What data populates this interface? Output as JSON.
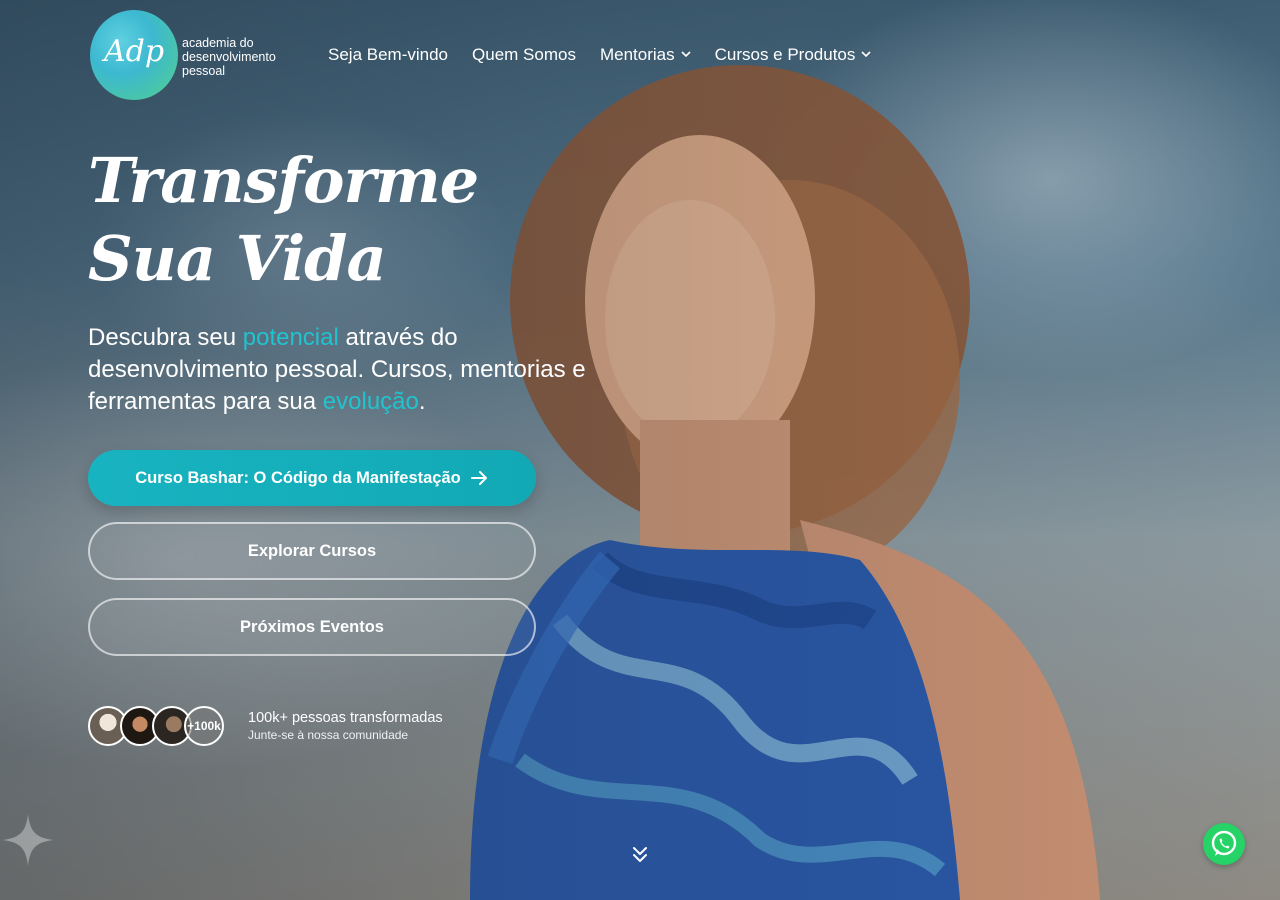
{
  "brand": {
    "logo_mark": "Adp",
    "logo_lines": [
      "academia do",
      "desenvolvimento",
      "pessoal"
    ]
  },
  "nav": {
    "items": [
      {
        "label": "Seja Bem-vindo",
        "has_dropdown": false
      },
      {
        "label": "Quem Somos",
        "has_dropdown": false
      },
      {
        "label": "Mentorias",
        "has_dropdown": true
      },
      {
        "label": "Cursos e Produtos",
        "has_dropdown": true
      }
    ]
  },
  "hero": {
    "headline_line1": "Transforme",
    "headline_line2": "Sua Vida",
    "sub": {
      "p1": "Descubra seu ",
      "accent1": "potencial",
      "p2": " através do desenvolvimento pessoal. Cursos, mentorias e ferramentas para sua ",
      "accent2": "evolução",
      "p3": "."
    },
    "primary_button": "Curso Bashar: O Código da Manifestação",
    "secondary_button_1": "Explorar Cursos",
    "secondary_button_2": "Próximos Eventos"
  },
  "community": {
    "count_badge": "+100k",
    "title": "100k+ pessoas transformadas",
    "subtitle": "Junte-se à nossa comunidade"
  },
  "colors": {
    "accent": "#21c3cf",
    "primary_button": "#14aebb",
    "whatsapp": "#25d366"
  },
  "icons": {
    "nav_dropdown": "chevron-down-icon",
    "primary_arrow": "arrow-right-icon",
    "scroll": "double-chevron-down-icon",
    "whatsapp": "whatsapp-icon",
    "decor": "sparkle-icon"
  }
}
